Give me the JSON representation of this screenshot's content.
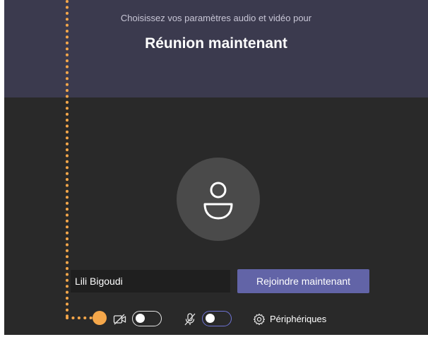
{
  "header": {
    "subtitle": "Choisissez vos paramètres audio et vidéo pour",
    "title": "Réunion maintenant"
  },
  "join_form": {
    "name_value": "Lili Bigoudi",
    "join_label": "Rejoindre maintenant"
  },
  "controls": {
    "camera": {
      "icon": "camera-off-icon",
      "state": "off"
    },
    "microphone": {
      "icon": "mic-off-icon",
      "state": "on"
    },
    "devices_label": "Périphériques",
    "devices_icon": "gear-icon"
  },
  "colors": {
    "header_bg": "#3b3a4e",
    "body_bg": "#292929",
    "accent": "#6264a7",
    "annotation": "#f5a74a"
  }
}
